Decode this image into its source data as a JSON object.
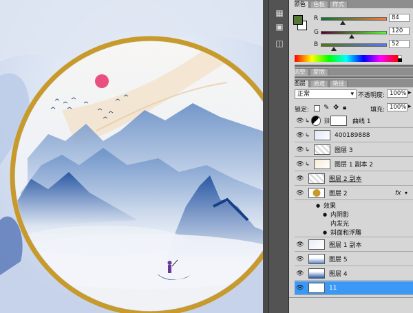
{
  "panels": {
    "top_tabs": [
      "颜色",
      "色板",
      "样式"
    ],
    "color": {
      "r_label": "R",
      "g_label": "G",
      "b_label": "B",
      "r_value": "84",
      "g_value": "120",
      "b_value": "52",
      "r_fraction": 0.33,
      "g_fraction": 0.47,
      "b_fraction": 0.2,
      "foreground": "#547834",
      "background": "#ffffff"
    },
    "mid_tabs": [
      "调整",
      "蒙版"
    ],
    "layer_tabs": [
      "图层",
      "通道",
      "路径"
    ],
    "blend_mode": "正常",
    "opacity_label": "不透明度:",
    "opacity_value": "100%",
    "lock_label": "锁定:",
    "fill_label": "填充:",
    "fill_value": "100%",
    "layers": [
      {
        "name": "曲线 1",
        "type": "adjustment"
      },
      {
        "name": "400189888",
        "type": "clip"
      },
      {
        "name": "图层 3",
        "type": "clip"
      },
      {
        "name": "图层 1 副本 2",
        "type": "clip"
      },
      {
        "name": "图层 2 副本",
        "type": "normal"
      },
      {
        "name": "图层 2",
        "type": "fx",
        "fx_badge": "fx"
      },
      {
        "name": "效果",
        "type": "effects-header"
      },
      {
        "name": "内阴影",
        "type": "effect"
      },
      {
        "name": "内发光",
        "type": "effect"
      },
      {
        "name": "斜面和浮雕",
        "type": "effect"
      },
      {
        "name": "图层 1 副本",
        "type": "normal"
      },
      {
        "name": "图层 5",
        "type": "normal"
      },
      {
        "name": "图层 4",
        "type": "normal"
      },
      {
        "name": "11",
        "type": "selected"
      }
    ]
  },
  "colors": {
    "accent": "#3b98f5",
    "gold": "#c79a2b",
    "sun": "#e8336a"
  }
}
